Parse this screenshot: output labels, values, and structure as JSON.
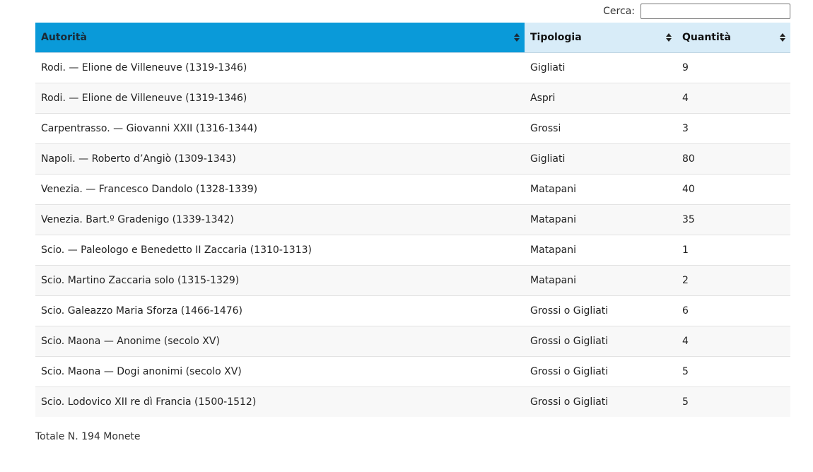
{
  "search": {
    "label": "Cerca:",
    "value": "",
    "placeholder": ""
  },
  "table": {
    "columns": [
      "Autorità",
      "Tipologia",
      "Quantità"
    ],
    "rows": [
      [
        "Rodi. — Elione de Villeneuve (1319-1346)",
        "Gigliati",
        "9"
      ],
      [
        "Rodi. — Elione de Villeneuve (1319-1346)",
        "Aspri",
        "4"
      ],
      [
        "Carpentrasso. — Giovanni XXII (1316-1344)",
        "Grossi",
        "3"
      ],
      [
        "Napoli. — Roberto d’Angiò (1309-1343)",
        "Gigliati",
        "80"
      ],
      [
        "Venezia. — Francesco Dandolo (1328-1339)",
        "Matapani",
        "40"
      ],
      [
        "Venezia. Bart.º Gradenigo (1339-1342)",
        "Matapani",
        "35"
      ],
      [
        "Scio. — Paleologo e Benedetto II Zaccaria (1310-1313)",
        "Matapani",
        "1"
      ],
      [
        "Scio. Martino Zaccaria solo (1315-1329)",
        "Matapani",
        "2"
      ],
      [
        "Scio. Galeazzo Maria Sforza (1466-1476)",
        "Grossi o Gigliati",
        "6"
      ],
      [
        "Scio. Maona — Anonime (secolo XV)",
        "Grossi o Gigliati",
        "4"
      ],
      [
        "Scio. Maona — Dogi anonimi (secolo XV)",
        "Grossi o Gigliati",
        "5"
      ],
      [
        "Scio. Lodovico XII re dì Francia (1500-1512)",
        "Grossi o Gigliati",
        "5"
      ]
    ]
  },
  "footer": {
    "total": "Totale N. 194 Monete"
  },
  "colors": {
    "sorted_header": "#0a9ad9",
    "header": "#d8ecf8",
    "row_alt": "#f8f8f8"
  },
  "icons": {
    "sort": "sort-up-down-icon"
  }
}
